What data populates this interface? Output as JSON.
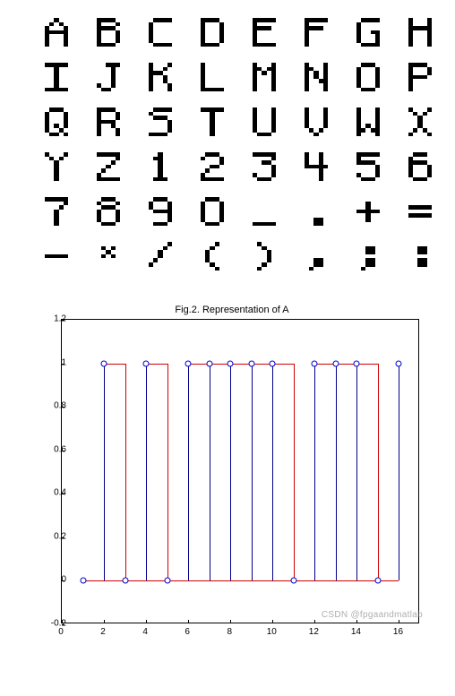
{
  "glyph_grid": {
    "rows": [
      [
        "A",
        "B",
        "C",
        "D",
        "E",
        "F",
        "G",
        "H"
      ],
      [
        "I",
        "J",
        "K",
        "L",
        "M",
        "N",
        "O",
        "P"
      ],
      [
        "Q",
        "R",
        "S",
        "T",
        "U",
        "V",
        "W",
        "X"
      ],
      [
        "Y",
        "Z",
        "1",
        "2",
        "3",
        "4",
        "5",
        "6"
      ],
      [
        "7",
        "8",
        "9",
        "0",
        "_",
        ".",
        "+",
        "="
      ],
      [
        "-",
        "*",
        "/",
        "(",
        ")",
        ",",
        ";",
        ":"
      ]
    ]
  },
  "glyph_bitmaps": {
    "A": [
      "00100",
      "01010",
      "10001",
      "11111",
      "10001",
      "10001",
      "10001"
    ],
    "B": [
      "11110",
      "10001",
      "11110",
      "10001",
      "10001",
      "10001",
      "11110"
    ],
    "C": [
      "01111",
      "10000",
      "10000",
      "10000",
      "10000",
      "10000",
      "01111"
    ],
    "D": [
      "11110",
      "10001",
      "10001",
      "10001",
      "10001",
      "10001",
      "11110"
    ],
    "E": [
      "11111",
      "10000",
      "11110",
      "10000",
      "10000",
      "10000",
      "11111"
    ],
    "F": [
      "11111",
      "10000",
      "11110",
      "10000",
      "10000",
      "10000",
      "10000"
    ],
    "G": [
      "01111",
      "10000",
      "10000",
      "10011",
      "10001",
      "10001",
      "01111"
    ],
    "H": [
      "10001",
      "10001",
      "11111",
      "10001",
      "10001",
      "10001",
      "10001"
    ],
    "I": [
      "11111",
      "00100",
      "00100",
      "00100",
      "00100",
      "00100",
      "11111"
    ],
    "J": [
      "00111",
      "00010",
      "00010",
      "00010",
      "00010",
      "10010",
      "01100"
    ],
    "K": [
      "10001",
      "10010",
      "11100",
      "10010",
      "10010",
      "10001",
      "10001"
    ],
    "L": [
      "10000",
      "10000",
      "10000",
      "10000",
      "10000",
      "10000",
      "11111"
    ],
    "M": [
      "10001",
      "11011",
      "10101",
      "10001",
      "10001",
      "10001",
      "10001"
    ],
    "N": [
      "10001",
      "11001",
      "10101",
      "10101",
      "10011",
      "10001",
      "10001"
    ],
    "O": [
      "01110",
      "10001",
      "10001",
      "10001",
      "10001",
      "10001",
      "01110"
    ],
    "P": [
      "11110",
      "10001",
      "10001",
      "11110",
      "10000",
      "10000",
      "10000"
    ],
    "Q": [
      "01110",
      "10001",
      "10001",
      "10001",
      "10101",
      "10010",
      "01101"
    ],
    "R": [
      "11110",
      "10001",
      "10001",
      "11110",
      "10010",
      "10001",
      "10001"
    ],
    "S": [
      "01111",
      "10000",
      "01110",
      "00001",
      "00001",
      "00001",
      "11110"
    ],
    "T": [
      "11111",
      "00100",
      "00100",
      "00100",
      "00100",
      "00100",
      "00100"
    ],
    "U": [
      "10001",
      "10001",
      "10001",
      "10001",
      "10001",
      "10001",
      "01110"
    ],
    "V": [
      "10001",
      "10001",
      "10001",
      "10001",
      "10001",
      "01010",
      "00100"
    ],
    "W": [
      "10001",
      "10001",
      "10001",
      "10001",
      "10101",
      "11011",
      "10001"
    ],
    "X": [
      "10001",
      "01010",
      "00100",
      "00100",
      "00100",
      "01010",
      "10001"
    ],
    "Y": [
      "10001",
      "01010",
      "00100",
      "00100",
      "00100",
      "00100",
      "00100"
    ],
    "Z": [
      "11111",
      "00001",
      "00010",
      "00100",
      "01000",
      "10000",
      "11111"
    ],
    "1": [
      "00100",
      "01100",
      "00100",
      "00100",
      "00100",
      "00100",
      "01110"
    ],
    "2": [
      "01110",
      "10001",
      "00001",
      "00110",
      "01000",
      "10000",
      "11111"
    ],
    "3": [
      "11111",
      "00001",
      "00110",
      "00001",
      "00001",
      "10001",
      "01110"
    ],
    "4": [
      "10010",
      "10010",
      "10010",
      "11111",
      "00010",
      "00010",
      "00010"
    ],
    "5": [
      "11111",
      "10000",
      "11110",
      "00001",
      "00001",
      "10001",
      "01110"
    ],
    "6": [
      "01110",
      "10000",
      "11110",
      "10001",
      "10001",
      "10001",
      "01110"
    ],
    "7": [
      "11111",
      "00001",
      "00010",
      "00100",
      "00100",
      "00100",
      "00100"
    ],
    "8": [
      "01110",
      "10001",
      "01110",
      "10001",
      "10001",
      "10001",
      "01110"
    ],
    "9": [
      "01110",
      "10001",
      "10001",
      "01111",
      "00001",
      "00001",
      "01110"
    ],
    "0": [
      "01110",
      "10001",
      "10001",
      "10001",
      "10001",
      "10001",
      "01110"
    ],
    "_": [
      "00000",
      "00000",
      "00000",
      "00000",
      "00000",
      "00000",
      "11111"
    ],
    ".": [
      "00000",
      "00000",
      "00000",
      "00000",
      "00000",
      "00110",
      "00110"
    ],
    "+": [
      "00000",
      "00100",
      "00100",
      "11111",
      "00100",
      "00100",
      "00000"
    ],
    "=": [
      "00000",
      "00000",
      "11111",
      "00000",
      "11111",
      "00000",
      "00000"
    ],
    "-": [
      "00000",
      "00000",
      "00000",
      "11111",
      "00000",
      "00000",
      "00000"
    ],
    "*": [
      "00000",
      "01010",
      "00100",
      "01010",
      "00000",
      "00000",
      "00000"
    ],
    "/": [
      "00001",
      "00010",
      "00100",
      "00100",
      "01000",
      "10000",
      "00000"
    ],
    "(": [
      "00010",
      "00100",
      "01000",
      "01000",
      "01000",
      "00100",
      "00010"
    ],
    ")": [
      "01000",
      "00100",
      "00010",
      "00010",
      "00010",
      "00100",
      "01000"
    ],
    ",": [
      "00000",
      "00000",
      "00000",
      "00000",
      "00110",
      "00110",
      "01000"
    ],
    ";": [
      "00000",
      "00110",
      "00110",
      "00000",
      "00110",
      "00110",
      "01000"
    ],
    ":": [
      "00000",
      "00110",
      "00110",
      "00000",
      "00110",
      "00110",
      "00000"
    ]
  },
  "chart_data": {
    "type": "stem",
    "title": "Fig.2. Representation of A",
    "x": [
      1,
      2,
      3,
      4,
      5,
      6,
      7,
      8,
      9,
      10,
      11,
      12,
      13,
      14,
      15,
      16
    ],
    "y": [
      0,
      1,
      0,
      1,
      0,
      1,
      1,
      1,
      1,
      1,
      0,
      1,
      1,
      1,
      0,
      1
    ],
    "xlim": [
      0,
      17
    ],
    "ylim": [
      -0.2,
      1.2
    ],
    "xticks": [
      0,
      2,
      4,
      6,
      8,
      10,
      12,
      14,
      16
    ],
    "yticks": [
      -0.2,
      0,
      0.2,
      0.4,
      0.6,
      0.8,
      1,
      1.2
    ],
    "stem_color": "#00008b",
    "marker_color": "#0000cd",
    "step_color": "#cd0000",
    "xlabel": "",
    "ylabel": ""
  },
  "watermark": "CSDN @fpgaandmatlab"
}
